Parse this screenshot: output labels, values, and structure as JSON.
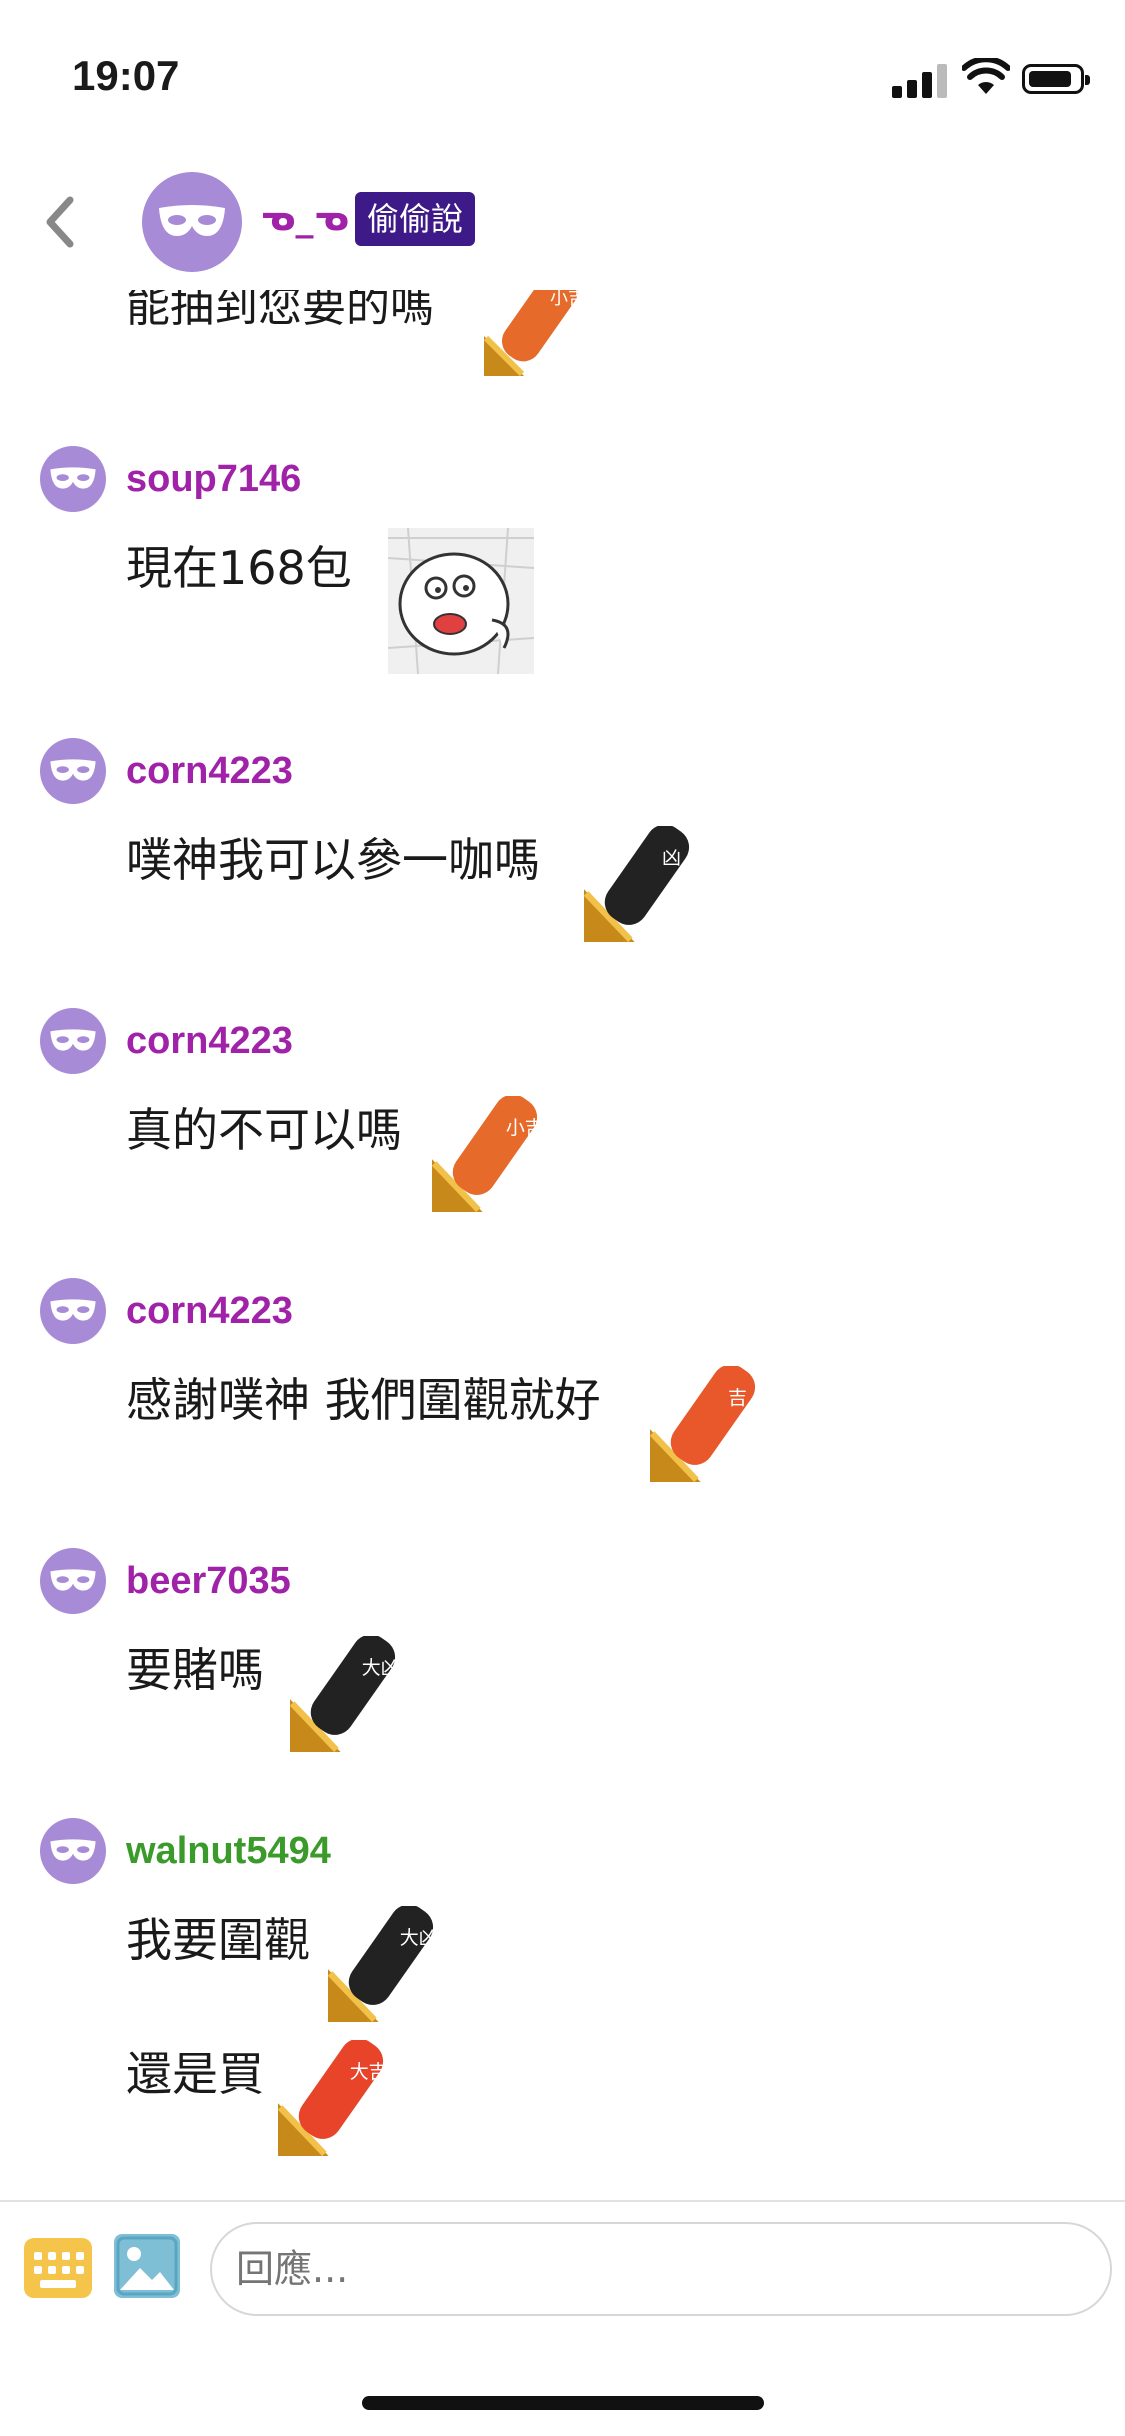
{
  "status": {
    "time": "19:07"
  },
  "header": {
    "name": "ᓀ_ᓀ",
    "badge": "偷偷說"
  },
  "partial_message": "能抽到您要的嗎",
  "messages": [
    {
      "user": "soup7146",
      "user_color": "#a022a8",
      "lines": [
        "現在168包"
      ]
    },
    {
      "user": "corn4223",
      "user_color": "#a022a8",
      "lines": [
        "噗神我可以參一咖嗎"
      ]
    },
    {
      "user": "corn4223",
      "user_color": "#a022a8",
      "lines": [
        "真的不可以嗎"
      ]
    },
    {
      "user": "corn4223",
      "user_color": "#a022a8",
      "lines": [
        "感謝噗神 我們圍觀就好"
      ]
    },
    {
      "user": "beer7035",
      "user_color": "#a022a8",
      "lines": [
        "要賭嗎"
      ]
    },
    {
      "user": "walnut5494",
      "user_color": "#3a9a2a",
      "lines": [
        "我要圍觀",
        "還是買"
      ]
    }
  ],
  "stickers": {
    "s0": "小吉",
    "s1": "face",
    "s2": "凶",
    "s3": "小吉",
    "s4": "吉",
    "s5": "大凶",
    "s6": "大凶",
    "s7": "大吉"
  },
  "input": {
    "placeholder": "回應..."
  },
  "colors": {
    "avatar": "#a78bd6",
    "badge_bg": "#3d1a87",
    "username_purple": "#a022a8",
    "username_green": "#3a9a2a"
  }
}
